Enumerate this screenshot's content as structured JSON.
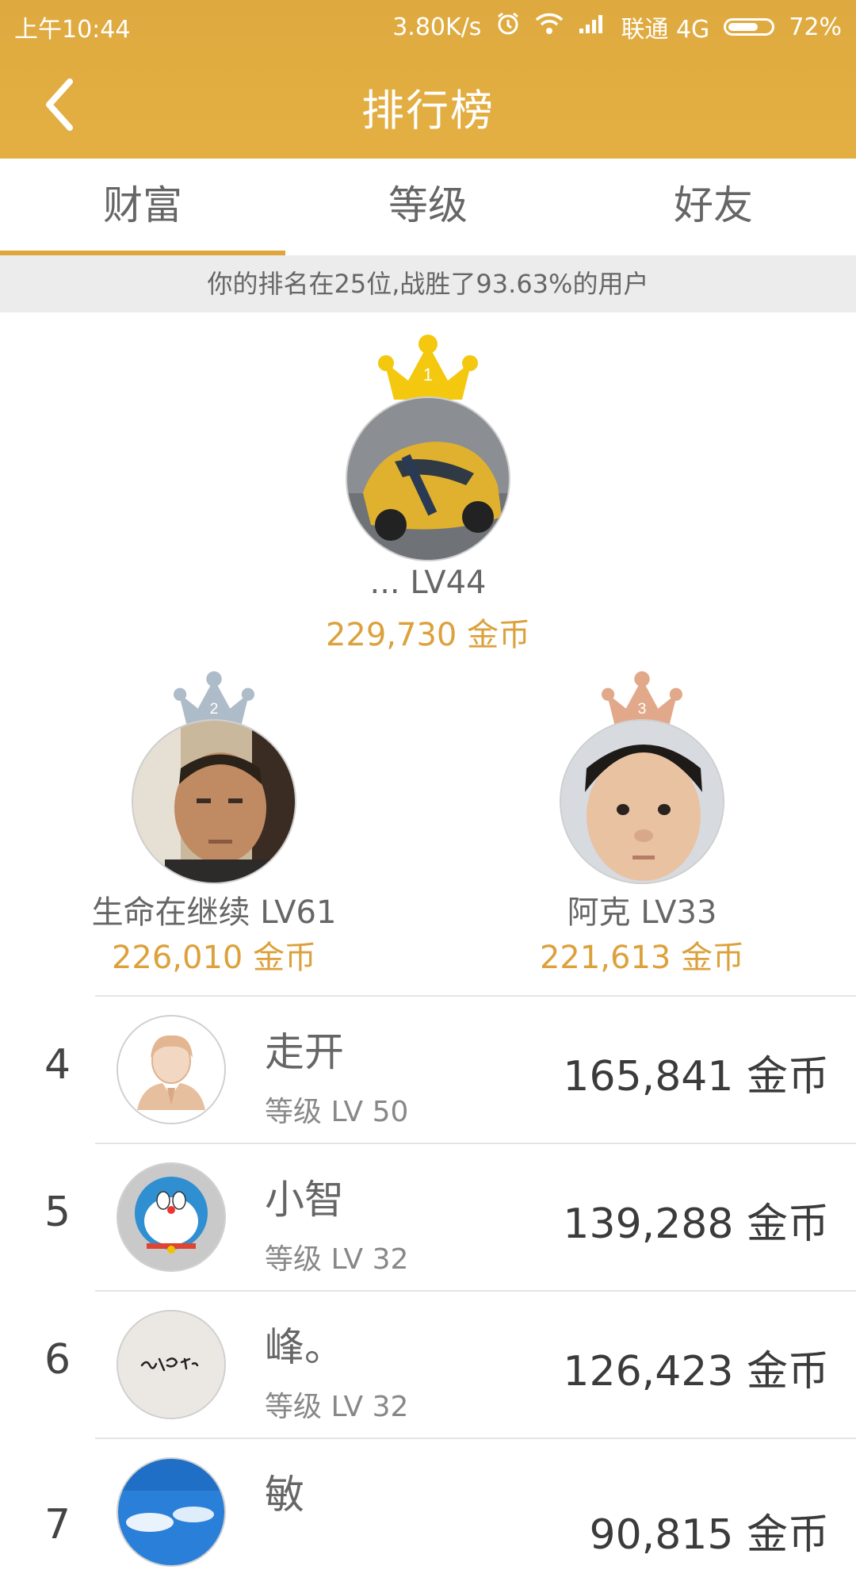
{
  "status_bar": {
    "time": "上午10:44",
    "speed": "3.80K/s",
    "carrier": "联通 4G",
    "battery_percent": "72%",
    "battery_level": 0.72,
    "icons": [
      "alarm-icon",
      "wifi-icon",
      "signal-icon",
      "battery-icon"
    ]
  },
  "app_bar": {
    "title": "排行榜",
    "back_icon": "chevron-left-icon"
  },
  "tabs": [
    {
      "label": "财富",
      "active": true
    },
    {
      "label": "等级",
      "active": false
    },
    {
      "label": "好友",
      "active": false
    }
  ],
  "notice": "你的排名在25位,战胜了93.63%的用户",
  "colors": {
    "header": "#e2ad41",
    "accent": "#e0a53c",
    "gold_crown": "#f1c40f",
    "silver_crown": "#aebbc8",
    "bronze_crown": "#e1a98a"
  },
  "podium": [
    {
      "rank": "1",
      "name_level": "... LV44",
      "coins": "229,730 金币",
      "avatar": "yellow-sports-car"
    },
    {
      "rank": "2",
      "name_level": "生命在继续 LV61",
      "coins": "226,010 金币",
      "avatar": "man-photo"
    },
    {
      "rank": "3",
      "name_level": "阿克 LV33",
      "coins": "221,613 金币",
      "avatar": "young-man-photo"
    }
  ],
  "ranking": [
    {
      "rank": "4",
      "name": "走开",
      "level": "等级 LV 50",
      "coins": "165,841 金币",
      "avatar": "default-user-icon"
    },
    {
      "rank": "5",
      "name": "小智",
      "level": "等级 LV 32",
      "coins": "139,288 金币",
      "avatar": "doraemon-photo"
    },
    {
      "rank": "6",
      "name": "峰。",
      "level": "等级 LV 32",
      "coins": "126,423 金币",
      "avatar": "handwriting-photo"
    },
    {
      "rank": "7",
      "name": "敏",
      "level": "",
      "coins": "90,815 金币",
      "avatar": "sky-photo"
    }
  ]
}
